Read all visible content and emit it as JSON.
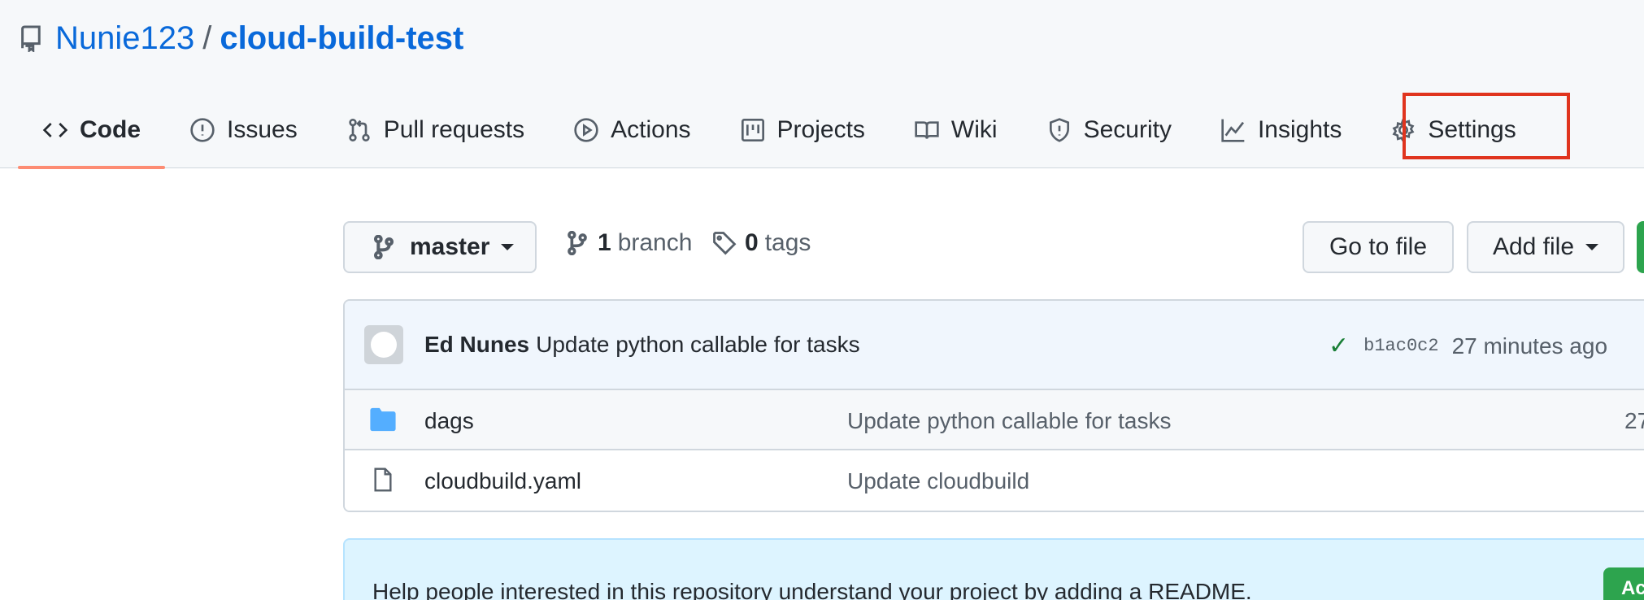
{
  "repo": {
    "owner": "Nunie123",
    "separator": "/",
    "name": "cloud-build-test"
  },
  "tabs": [
    {
      "label": "Code",
      "icon": "code-icon"
    },
    {
      "label": "Issues",
      "icon": "issue-icon"
    },
    {
      "label": "Pull requests",
      "icon": "pull-request-icon"
    },
    {
      "label": "Actions",
      "icon": "play-icon"
    },
    {
      "label": "Projects",
      "icon": "project-icon"
    },
    {
      "label": "Wiki",
      "icon": "book-icon"
    },
    {
      "label": "Security",
      "icon": "shield-icon"
    },
    {
      "label": "Insights",
      "icon": "graph-icon"
    },
    {
      "label": "Settings",
      "icon": "gear-icon"
    }
  ],
  "active_tab": "Code",
  "highlight_color": "#e0341e",
  "toolbar": {
    "branch": "master",
    "branch_count": "1",
    "branch_word": "branch",
    "tag_count": "0",
    "tag_word": "tags",
    "go_to_file": "Go to file",
    "add_file": "Add file"
  },
  "latest_commit": {
    "author": "Ed Nunes",
    "message": "Update python callable for tasks",
    "sha": "b1ac0c2",
    "time": "27 minutes ago"
  },
  "files": [
    {
      "name": "dags",
      "type": "folder",
      "message": "Update python callable for tasks",
      "age": "27"
    },
    {
      "name": "cloudbuild.yaml",
      "type": "file",
      "message": "Update cloudbuild",
      "age": ""
    }
  ],
  "readme_prompt": {
    "text": "Help people interested in this repository understand your project by adding a README.",
    "button": "Ac"
  }
}
